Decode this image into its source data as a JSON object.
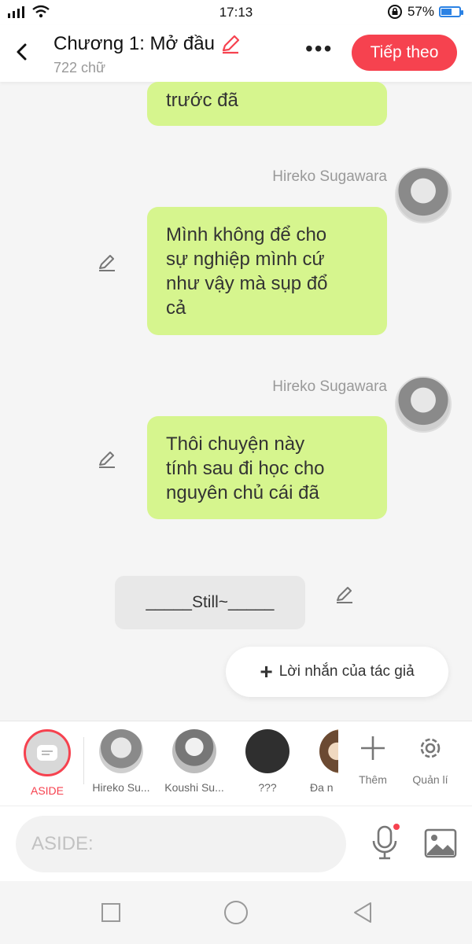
{
  "status_bar": {
    "time": "17:13",
    "battery": "57%",
    "battery_level": 0.57
  },
  "header": {
    "title": "Chương 1: Mở đầu",
    "word_count": "722 chữ",
    "next_label": "Tiếp theo"
  },
  "messages": [
    {
      "text_lines": [
        "trước đã"
      ]
    },
    {
      "sender": "Hireko Sugawara",
      "text_lines": [
        "Mình không để cho",
        "sự nghiệp mình cứ",
        "như vậy mà sụp đổ",
        "cả"
      ]
    },
    {
      "sender": "Hireko Sugawara",
      "text_lines": [
        "Thôi chuyện này",
        "tính sau đi học cho",
        "nguyên chủ cái đã"
      ]
    }
  ],
  "aside_message": "_____Still~_____",
  "author_note": {
    "plus": "+",
    "label": "Lời nhắn của tác giả"
  },
  "characters": [
    {
      "label": "ASIDE",
      "icon": "aside-icon"
    },
    {
      "label": "Hireko Su..."
    },
    {
      "label": "Koushi Su..."
    },
    {
      "label": "???"
    },
    {
      "label": "Đa n"
    }
  ],
  "tools": {
    "add_label": "Thêm",
    "manage_label": "Quản lí"
  },
  "composer": {
    "placeholder": "ASIDE:"
  },
  "colors": {
    "accent": "#f6424f",
    "bubble": "#d6f58e"
  }
}
